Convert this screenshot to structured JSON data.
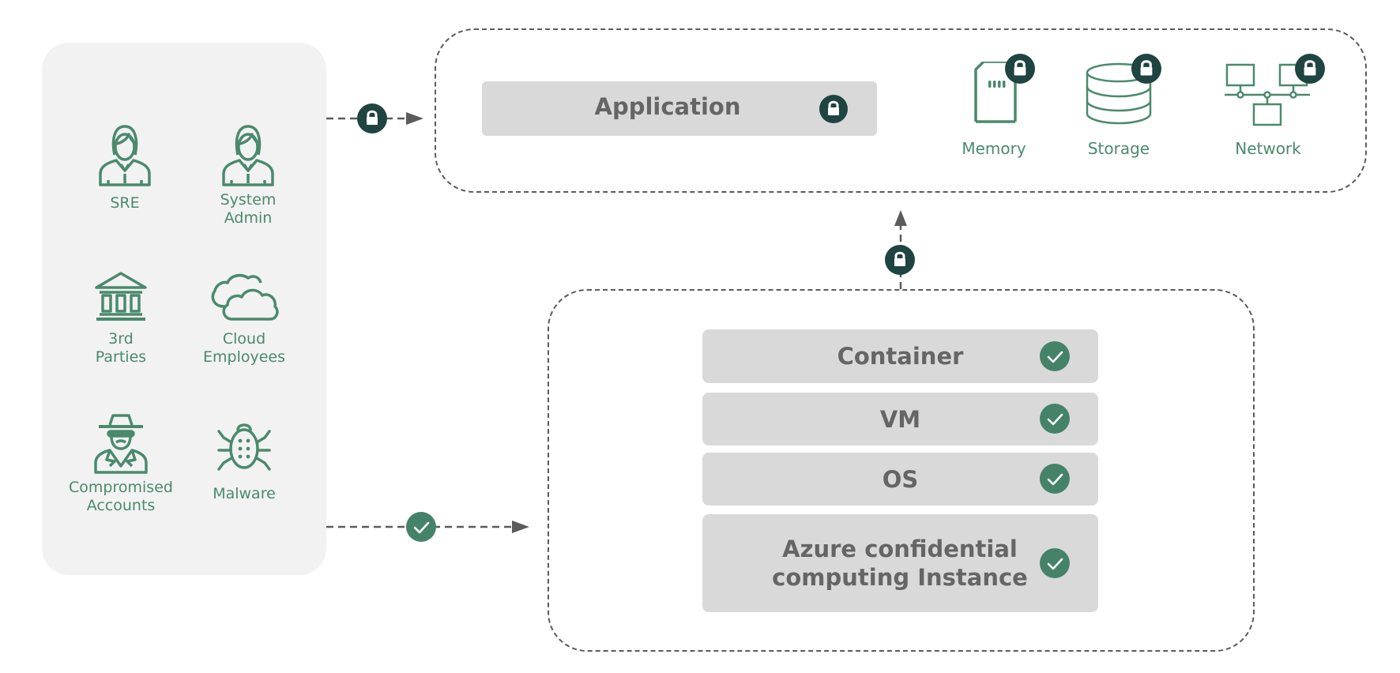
{
  "colors": {
    "icon_green": "#4a8a6c",
    "lock_badge": "#1f4441",
    "check_badge": "#448367",
    "bar_fill": "#d9d9d9",
    "bar_text": "#656565",
    "panel_fill": "#f2f2f2",
    "dash_stroke": "#5b5b5b"
  },
  "threat_actors": [
    {
      "icon": "female-user-icon",
      "label": "SRE"
    },
    {
      "icon": "female-user-icon",
      "label": "System Admin"
    },
    {
      "icon": "bank-building-icon",
      "label": "3rd Parties"
    },
    {
      "icon": "cloud-icon",
      "label": "Cloud Employees"
    },
    {
      "icon": "spy-hacker-icon",
      "label": "Compromised Accounts"
    },
    {
      "icon": "bug-icon",
      "label": "Malware"
    }
  ],
  "top_box": {
    "application": {
      "label": "Application",
      "badge": "lock-icon"
    },
    "resources": [
      {
        "icon": "memory-card-icon",
        "label": "Memory",
        "badge": "lock-icon"
      },
      {
        "icon": "database-icon",
        "label": "Storage",
        "badge": "lock-icon"
      },
      {
        "icon": "network-icon",
        "label": "Network",
        "badge": "lock-icon"
      }
    ]
  },
  "bottom_box": {
    "layers": [
      {
        "label": "Container",
        "badge": "check-icon"
      },
      {
        "label": "VM",
        "badge": "check-icon"
      },
      {
        "label": "OS",
        "badge": "check-icon"
      },
      {
        "label": "Azure confidential computing Instance",
        "badge": "check-icon"
      }
    ]
  },
  "connectors": [
    {
      "from": "threat-panel",
      "to": "top-box",
      "badge": "lock-icon",
      "meaning": "blocked"
    },
    {
      "from": "threat-panel",
      "to": "bottom-box",
      "badge": "check-icon",
      "meaning": "allowed"
    },
    {
      "from": "bottom-box",
      "to": "top-box",
      "badge": "lock-icon",
      "meaning": "blocked"
    }
  ]
}
